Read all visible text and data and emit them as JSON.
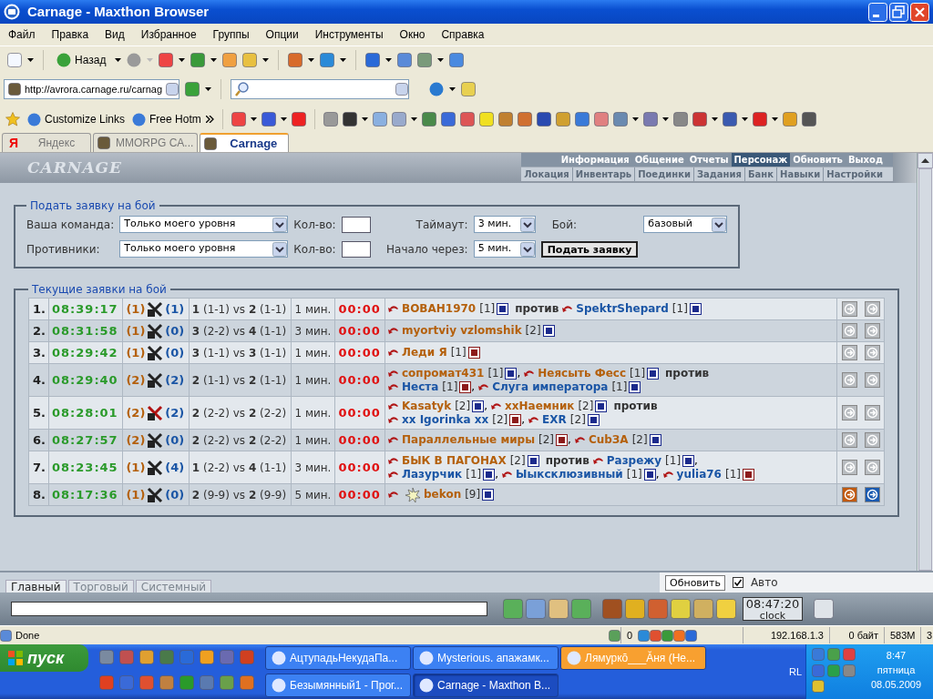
{
  "window": {
    "title": "Carnage - Maxthon Browser"
  },
  "menu": [
    "Файл",
    "Правка",
    "Вид",
    "Избранное",
    "Группы",
    "Опции",
    "Инструменты",
    "Окно",
    "Справка"
  ],
  "toolbar": {
    "back_label": "Назад"
  },
  "address": {
    "url": "http://avrora.carnage.ru/carnag"
  },
  "links": [
    "Customize Links",
    "Free Hotm"
  ],
  "tabs": [
    {
      "label": "Яндекс",
      "icon_text": "Я",
      "selected": false
    },
    {
      "label": "MMORPG CA...",
      "selected": false
    },
    {
      "label": "Carnage",
      "selected": true
    }
  ],
  "game": {
    "logo": "CARNAGE",
    "nav_top": [
      {
        "label": "Информация",
        "selected": false
      },
      {
        "label": "Общение",
        "selected": false
      },
      {
        "label": "Отчеты",
        "selected": false
      },
      {
        "label": "Персонаж",
        "selected": true
      },
      {
        "label": "Обновить",
        "selected": false
      },
      {
        "label": "Выход",
        "selected": false
      }
    ],
    "nav_bottom": [
      "Локация",
      "Инвентарь",
      "Поединки",
      "Задания",
      "Банк",
      "Навыки",
      "Настройки"
    ]
  },
  "form": {
    "title": "Подать заявку на бой",
    "team_label": "Ваша команда:",
    "team_value": "Только моего уровня",
    "count_label_1": "Кол-во:",
    "timeout_label": "Таймаут:",
    "timeout_value": "3 мин.",
    "type_label": "Бой:",
    "type_value": "базовый",
    "enemy_label": "Противники:",
    "enemy_value": "Только моего уровня",
    "count_label_2": "Кол-во:",
    "start_label": "Начало через:",
    "start_value": "5 мин.",
    "submit": "Подать заявку"
  },
  "battles": {
    "title": "Текущие заявки на бой",
    "rows": [
      {
        "num": "1.",
        "time": "08:39:17",
        "left": "(1)",
        "right": "(1)",
        "kind": "normal",
        "teams": "**1** (1-1) vs **2** (1-1)",
        "timeout": "1 мин.",
        "timer": "00:00",
        "active": false,
        "lines": [
          [
            {
              "kind": "player",
              "color": "#b4600c",
              "name": "BOBAH1970",
              "level": "[1]",
              "badge": {
                "color": "#1b2a8c"
              }
            },
            {
              "kind": "vs",
              "text": "против"
            },
            {
              "kind": "player",
              "color": "#1a55a5",
              "name": "SpektrShepard",
              "level": "[1]",
              "badge": {
                "color": "#1b2a8c"
              }
            }
          ]
        ]
      },
      {
        "num": "2.",
        "time": "08:31:58",
        "left": "(1)",
        "right": "(0)",
        "kind": "normal",
        "teams": "**3** (2-2) vs **4** (1-1)",
        "timeout": "3 мин.",
        "timer": "00:00",
        "active": false,
        "lines": [
          [
            {
              "kind": "player",
              "color": "#b4600c",
              "name": "myortviy vzlomshik",
              "level": "[2]",
              "badge": {
                "color": "#1b2a8c"
              }
            }
          ]
        ]
      },
      {
        "num": "3.",
        "time": "08:29:42",
        "left": "(1)",
        "right": "(0)",
        "kind": "normal",
        "teams": "**3** (1-1) vs **3** (1-1)",
        "timeout": "1 мин.",
        "timer": "00:00",
        "active": false,
        "lines": [
          [
            {
              "kind": "player",
              "color": "#b4600c",
              "name": "Леди Я",
              "level": "[1]",
              "badge": {
                "color": "#8c1b1b"
              }
            }
          ]
        ]
      },
      {
        "num": "4.",
        "time": "08:29:40",
        "left": "(2)",
        "right": "(2)",
        "kind": "normal",
        "teams": "**2** (1-1) vs **2** (1-1)",
        "timeout": "1 мин.",
        "timer": "00:00",
        "active": false,
        "lines": [
          [
            {
              "kind": "player",
              "color": "#b4600c",
              "name": "сопромат431",
              "level": "[1]",
              "badge": {
                "color": "#1b2a8c"
              }
            },
            {
              "kind": "sep",
              "text": ","
            },
            {
              "kind": "player",
              "color": "#b4600c",
              "name": "Неясыть Фесс",
              "level": "[1]",
              "badge": {
                "color": "#1b2a8c"
              }
            },
            {
              "kind": "vs",
              "text": "против"
            }
          ],
          [
            {
              "kind": "player",
              "color": "#1a55a5",
              "name": "Неста",
              "level": "[1]",
              "badge": {
                "color": "#8c1b1b"
              }
            },
            {
              "kind": "sep",
              "text": ","
            },
            {
              "kind": "player",
              "color": "#1a55a5",
              "name": "Слуга императора",
              "level": "[1]",
              "badge": {
                "color": "#1b2a8c"
              }
            }
          ]
        ]
      },
      {
        "num": "5.",
        "time": "08:28:01",
        "left": "(2)",
        "right": "(2)",
        "kind": "bloody",
        "teams": "**2** (2-2) vs **2** (2-2)",
        "timeout": "1 мин.",
        "timer": "00:00",
        "active": false,
        "lines": [
          [
            {
              "kind": "player",
              "color": "#b4600c",
              "name": "Kasatyk",
              "level": "[2]",
              "badge": {
                "color": "#1b2a8c"
              }
            },
            {
              "kind": "sep",
              "text": ","
            },
            {
              "kind": "player",
              "color": "#b4600c",
              "name": "xxHaемник",
              "level": "[2]",
              "badge": {
                "color": "#1b2a8c"
              }
            },
            {
              "kind": "vs",
              "text": "против"
            }
          ],
          [
            {
              "kind": "player",
              "color": "#1a55a5",
              "name": "xx Igorinka xx",
              "level": "[2]",
              "badge": {
                "color": "#8c1b1b"
              }
            },
            {
              "kind": "sep",
              "text": ","
            },
            {
              "kind": "player",
              "color": "#1a55a5",
              "name": "EXR",
              "level": "[2]",
              "badge": {
                "color": "#1b2a8c"
              }
            }
          ]
        ]
      },
      {
        "num": "6.",
        "time": "08:27:57",
        "left": "(2)",
        "right": "(0)",
        "kind": "normal",
        "teams": "**2** (2-2) vs **2** (2-2)",
        "timeout": "1 мин.",
        "timer": "00:00",
        "active": false,
        "lines": [
          [
            {
              "kind": "player",
              "color": "#b4600c",
              "name": "Параллельные миры",
              "level": "[2]",
              "badge": {
                "color": "#8c1b1b"
              }
            },
            {
              "kind": "sep",
              "text": ","
            },
            {
              "kind": "player",
              "color": "#b4600c",
              "name": "CubЗA",
              "level": "[2]",
              "badge": {
                "color": "#1b2a8c"
              }
            }
          ]
        ]
      },
      {
        "num": "7.",
        "time": "08:23:45",
        "left": "(1)",
        "right": "(4)",
        "kind": "normal",
        "teams": "**1** (2-2) vs **4** (1-1)",
        "timeout": "3 мин.",
        "timer": "00:00",
        "active": false,
        "lines": [
          [
            {
              "kind": "player",
              "color": "#b4600c",
              "name": "БЫК В ПАГОНАХ",
              "level": "[2]",
              "badge": {
                "color": "#1b2a8c"
              }
            },
            {
              "kind": "vs",
              "text": "против"
            },
            {
              "kind": "player",
              "color": "#1a55a5",
              "name": "Разрежу",
              "level": "[1]",
              "badge": {
                "color": "#1b2a8c"
              }
            },
            {
              "kind": "sep",
              "text": ","
            }
          ],
          [
            {
              "kind": "player",
              "color": "#1a55a5",
              "name": "Лазурчик",
              "level": "[1]",
              "badge": {
                "color": "#1b2a8c"
              }
            },
            {
              "kind": "sep",
              "text": ","
            },
            {
              "kind": "player",
              "color": "#1a55a5",
              "name": "Ыыксклюзивный",
              "level": "[1]",
              "badge": {
                "color": "#1b2a8c"
              }
            },
            {
              "kind": "sep",
              "text": ","
            },
            {
              "kind": "player",
              "color": "#1a55a5",
              "name": "yulia76",
              "level": "[1]",
              "badge": {
                "color": "#8c1b1b"
              }
            }
          ]
        ]
      },
      {
        "num": "8.",
        "time": "08:17:36",
        "left": "(1)",
        "right": "(0)",
        "kind": "normal",
        "teams": "**2** (9-9) vs **2** (9-9)",
        "timeout": "5 мин.",
        "timer": "00:00",
        "active": true,
        "lines": [
          [
            {
              "kind": "player",
              "color": "#b4600c",
              "name": "bekon",
              "level": "[9]",
              "badge": {
                "color": "#1b2a8c"
              },
              "emblem": true
            }
          ]
        ]
      }
    ]
  },
  "chat": {
    "tabs": [
      {
        "label": "Главный",
        "selected": true
      },
      {
        "label": "Торговый",
        "selected": false
      },
      {
        "label": "Системный",
        "selected": false
      }
    ],
    "refresh": "Обновить",
    "auto_label": "Авто",
    "auto_checked": true,
    "clock": "08:47:20",
    "clock_label": "clock"
  },
  "status_bar": {
    "text": "Done",
    "count": "0",
    "ip": "192.168.1.3",
    "traffic": "0 байт",
    "memory": "583M",
    "pages": "3"
  },
  "taskbar": {
    "start": "пуск",
    "tasks": [
      {
        "label": "АцтупадьНекудаПа...",
        "selected": false,
        "flashing": false
      },
      {
        "label": "Mysterious. апажамк...",
        "selected": false,
        "flashing": false
      },
      {
        "label": "Лямуркŏ___Ăня (Не...",
        "selected": false,
        "flashing": true
      },
      {
        "label": "Безымянный1 - Прог...",
        "selected": false,
        "flashing": false
      },
      {
        "label": "Carnage - Maxthon B...",
        "selected": true,
        "flashing": false
      }
    ],
    "lang": "RL",
    "time": "8:47",
    "day": "пятница",
    "date": "08.05.2009"
  }
}
